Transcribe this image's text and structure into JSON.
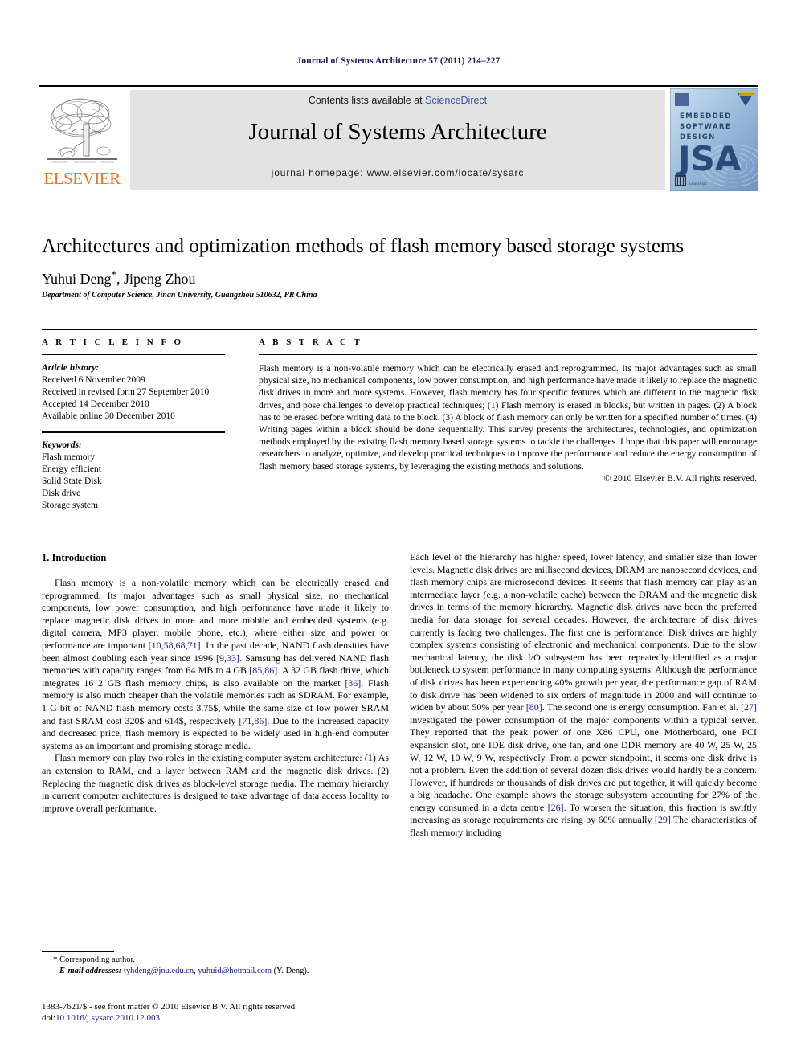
{
  "running_head": "Journal of Systems Architecture 57 (2011) 214–227",
  "masthead": {
    "contents_prefix": "Contents lists available at ",
    "sciencedirect": "ScienceDirect",
    "journal_name": "Journal of Systems Architecture",
    "homepage": "journal homepage: www.elsevier.com/locate/sysarc",
    "publisher_logo_text": "ELSEVIER",
    "cover": {
      "line1": "EMBEDDED",
      "line2": "SOFTWARE",
      "line3": "DESIGN",
      "acronym": "JSA"
    },
    "colors": {
      "link": "#3a53a4",
      "elsevier_orange": "#E87722",
      "banner_bg": "#e3e3e3",
      "cover_blue": "#7fa5cf"
    }
  },
  "article": {
    "title": "Architectures and optimization methods of flash memory based storage systems",
    "authors": "Yuhui Deng",
    "author_star": "*",
    "authors_rest": ", Jipeng Zhou",
    "affiliation": "Department of Computer Science, Jinan University, Guangzhou 510632, PR China"
  },
  "article_info": {
    "heading": "A R T I C L E   I N F O",
    "history_label": "Article history:",
    "history": [
      "Received 6 November 2009",
      "Received in revised form 27 September 2010",
      "Accepted 14 December 2010",
      "Available online 30 December 2010"
    ],
    "keywords_label": "Keywords:",
    "keywords": [
      "Flash memory",
      "Energy efficient",
      "Solid State Disk",
      "Disk drive",
      "Storage system"
    ]
  },
  "abstract": {
    "heading": "A B S T R A C T",
    "text": "Flash memory is a non-volatile memory which can be electrically erased and reprogrammed. Its major advantages such as small physical size, no mechanical components, low power consumption, and high performance have made it likely to replace the magnetic disk drives in more and more systems. However, flash memory has four specific features which are different to the magnetic disk drives, and pose challenges to develop practical techniques; (1) Flash memory is erased in blocks, but written in pages. (2) A block has to be erased before writing data to the block. (3) A block of flash memory can only be written for a specified number of times. (4) Writing pages within a block should be done sequentially. This survey presents the architectures, technologies, and optimization methods employed by the existing flash memory based storage systems to tackle the challenges. I hope that this paper will encourage researchers to analyze, optimize, and develop practical techniques to improve the performance and reduce the energy consumption of flash memory based storage systems, by leveraging the existing methods and solutions.",
    "copyright": "© 2010 Elsevier B.V. All rights reserved."
  },
  "body": {
    "section_heading": "1. Introduction",
    "left_paragraph_1": "Flash memory is a non-volatile memory which can be electrically erased and reprogrammed. Its major advantages such as small physical size, no mechanical components, low power consumption, and high performance have made it likely to replace magnetic disk drives in more and more mobile and embedded systems (e.g. digital camera, MP3 player, mobile phone, etc.), where either size and power or performance are important [10,58,68,71]. In the past decade, NAND flash densities have been almost doubling each year since 1996 [9,33]. Samsung has delivered NAND flash memories with capacity ranges from 64 MB to 4 GB [85,86]. A 32 GB flash drive, which integrates 16 2 GB flash memory chips, is also available on the market [86]. Flash memory is also much cheaper than the volatile memories such as SDRAM. For example, 1 G bit of NAND flash memory costs 3.75$, while the same size of low power SRAM and fast SRAM cost 320$ and 614$, respectively [71,86]. Due to the increased capacity and decreased price, flash memory is expected to be widely used in high-end computer systems as an important and promising storage media.",
    "left_paragraph_2": "Flash memory can play two roles in the existing computer system architecture: (1) As an extension to RAM, and a layer between RAM and the magnetic disk drives. (2) Replacing the magnetic disk drives as block-level storage media. The memory hierarchy in current computer architectures is designed to take advantage of data access locality to improve overall performance.",
    "right_paragraph_1": "Each level of the hierarchy has higher speed, lower latency, and smaller size than lower levels. Magnetic disk drives are millisecond devices, DRAM are nanosecond devices, and flash memory chips are microsecond devices. It seems that flash memory can play as an intermediate layer (e.g. a non-volatile cache) between the DRAM and the magnetic disk drives in terms of the memory hierarchy. Magnetic disk drives have been the preferred media for data storage for several decades. However, the architecture of disk drives currently is facing two challenges. The first one is performance. Disk drives are highly complex systems consisting of electronic and mechanical components. Due to the slow mechanical latency, the disk I/O subsystem has been repeatedly identified as a major bottleneck to system performance in many computing systems. Although the performance of disk drives has been experiencing 40% growth per year, the performance gap of RAM to disk drive has been widened to six orders of magnitude in 2000 and will continue to widen by about 50% per year [80]. The second one is energy consumption. Fan et al. [27] investigated the power consumption of the major components within a typical server. They reported that the peak power of one X86 CPU, one Motherboard, one PCI expansion slot, one IDE disk drive, one fan, and one DDR memory are 40 W, 25 W, 25 W, 12 W, 10 W, 9 W, respectively. From a power standpoint, it seems one disk drive is not a problem. Even the addition of several dozen disk drives would hardly be a concern. However, if hundreds or thousands of disk drives are put together, it will quickly become a big headache. One example shows the storage subsystem accounting for 27% of the energy consumed in a data centre [26]. To worsen the situation, this fraction is swiftly increasing as storage requirements are rising by 60% annually [29].The characteristics of flash memory including"
  },
  "footnote": {
    "star": "*",
    "corresponding": "Corresponding author.",
    "email_label": "E-mail addresses:",
    "email1": "tyhdeng@jnu.edu.cn",
    "email2": "yuhuid@hotmail.com",
    "email_suffix": "(Y. Deng)."
  },
  "imprint": {
    "line1": "1383-7621/$ - see front matter © 2010 Elsevier B.V. All rights reserved.",
    "doi_prefix": "doi:",
    "doi": "10.1016/j.sysarc.2010.12.003"
  }
}
